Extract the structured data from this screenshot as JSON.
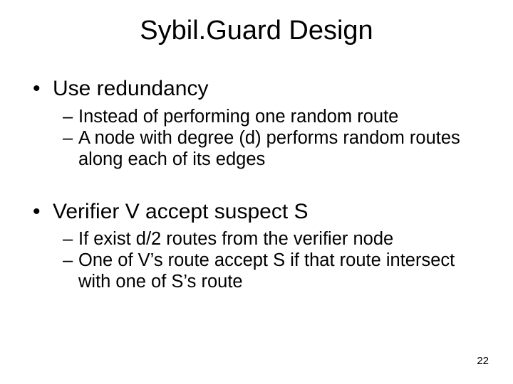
{
  "title": "Sybil.Guard Design",
  "sections": [
    {
      "heading": "Use redundancy",
      "items": [
        "Instead of performing one random route",
        "A node with degree (d) performs random routes along each of its edges"
      ]
    },
    {
      "heading": "Verifier V accept suspect S",
      "items": [
        "If exist d/2 routes from the verifier node",
        "One of V’s route accept S if that route intersect with one of S’s route"
      ]
    }
  ],
  "page_number": "22",
  "glyphs": {
    "bullet": "•",
    "dash": "–"
  }
}
